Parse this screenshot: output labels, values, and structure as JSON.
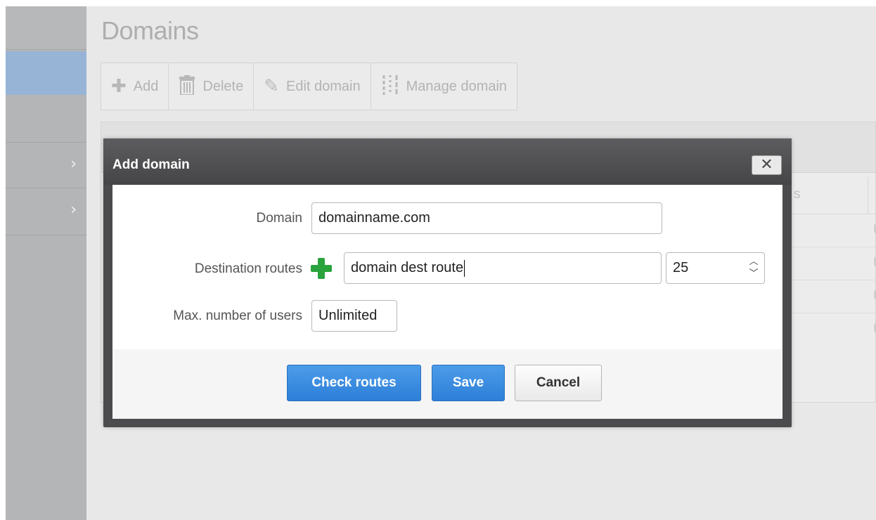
{
  "page": {
    "title": "Domains"
  },
  "toolbar": {
    "add_label": "Add",
    "delete_label": "Delete",
    "edit_label": "Edit domain",
    "manage_label": "Manage domain"
  },
  "background_table": {
    "partial_header": "s",
    "partial_cells": [
      "U",
      "U",
      "U",
      "U"
    ]
  },
  "modal": {
    "title": "Add domain",
    "close_glyph": "✕",
    "fields": {
      "domain_label": "Domain",
      "domain_value": "domainname.com",
      "routes_label": "Destination routes",
      "route_value": "domain dest route",
      "port_value": "25",
      "max_users_label": "Max. number of users",
      "max_users_value": "Unlimited"
    },
    "buttons": {
      "check_routes": "Check routes",
      "save": "Save",
      "cancel": "Cancel"
    }
  },
  "colors": {
    "primary": "#2c7fd8",
    "add_icon": "#2aa33c",
    "sidebar_active": "#97b4d6"
  }
}
